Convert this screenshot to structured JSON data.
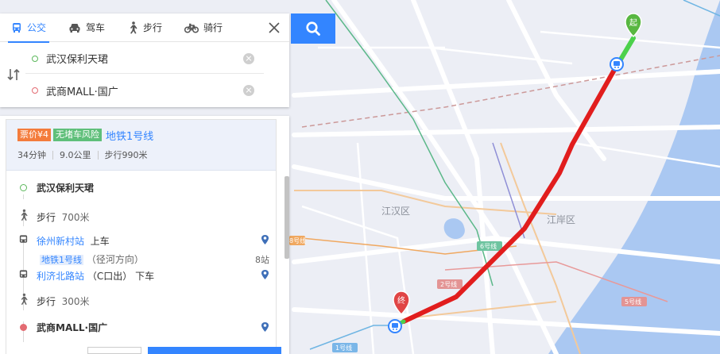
{
  "modes": [
    {
      "label": "公交",
      "icon": "bus-icon",
      "active": true
    },
    {
      "label": "驾车",
      "icon": "car-icon",
      "active": false
    },
    {
      "label": "步行",
      "icon": "walk-icon",
      "active": false
    },
    {
      "label": "骑行",
      "icon": "bike-icon",
      "active": false
    }
  ],
  "route_input": {
    "start": "武汉保利天珺",
    "end": "武商MALL·国广"
  },
  "plan": {
    "price_tag": "票价¥4",
    "safe_tag": "无堵车风险",
    "line_name": "地铁1号线",
    "duration": "34分钟",
    "distance": "9.0公里",
    "walk": "步行990米"
  },
  "steps": {
    "start_name": "武汉保利天珺",
    "walk1_label": "步行",
    "walk1_dist": "700米",
    "board_station": "徐州新村站",
    "board_action": "上车",
    "line_badge": "地铁1号线",
    "direction": "（径河方向）",
    "stop_count": "8站",
    "alight_station": "利济北路站",
    "alight_exit": "（C口出）",
    "alight_action": "下车",
    "walk2_label": "步行",
    "walk2_dist": "300米",
    "end_name": "武商MALL·国广"
  },
  "map": {
    "district_1": "江汉区",
    "district_2": "江岸区",
    "start_marker": "起",
    "end_marker": "终",
    "line_tags": [
      "6号线",
      "2号线",
      "1号线",
      "5号线",
      "8号线"
    ],
    "route_color": "#e11d1d",
    "walk_color": "#4cd14c",
    "accent": "#3385ff"
  }
}
